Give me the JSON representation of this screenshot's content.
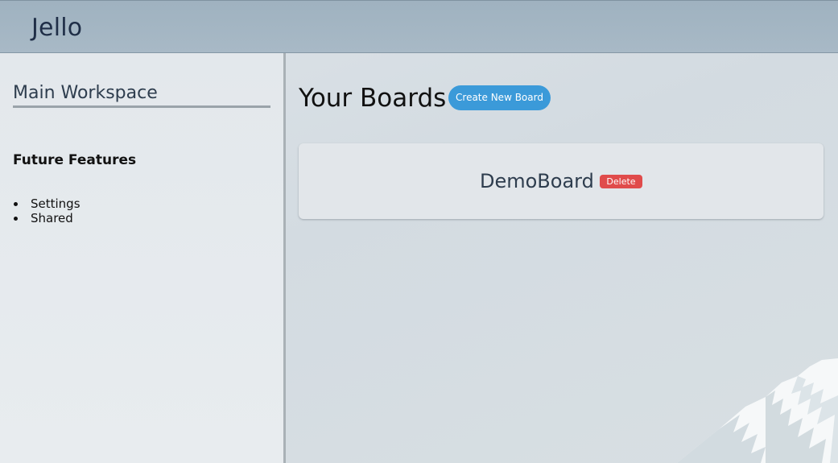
{
  "header": {
    "app_title": "Jello"
  },
  "sidebar": {
    "workspace_title": "Main Workspace",
    "future_title": "Future Features",
    "future_items": [
      "Settings",
      "Shared"
    ]
  },
  "main": {
    "title": "Your Boards",
    "create_label": "Create New Board",
    "boards": [
      {
        "name": "DemoBoard",
        "delete_label": "Delete"
      }
    ]
  },
  "colors": {
    "header_bg": "#a3b5c3",
    "title_text": "#1f2e47",
    "create_button": "#3b9ad9",
    "delete_button": "#e04b4b"
  }
}
